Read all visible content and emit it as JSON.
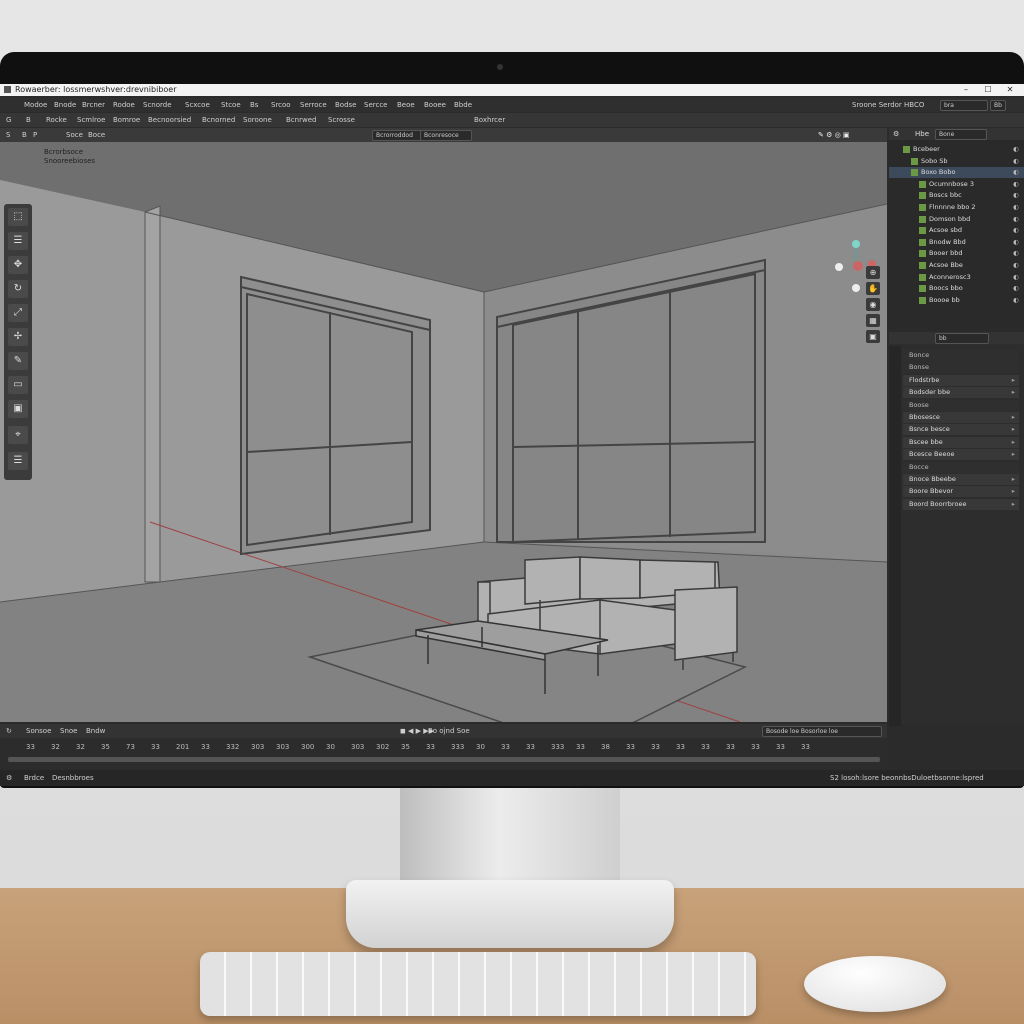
{
  "window": {
    "title": "Rowaerber: lossmerwshver:drevnibiboer",
    "controls": [
      "–",
      "☐",
      "✕"
    ]
  },
  "menubar": {
    "items": [
      "Modoe",
      "Bnode",
      "Brcner",
      "Rodoe",
      "Scnorde",
      "Scxcoe",
      "Stcoe",
      "Bs",
      "Srcoo",
      "Serroce",
      "Bodse",
      "Sercce",
      "Beoe",
      "Booee",
      "Bbde"
    ],
    "right_label": "Sroone Serdor HBCO",
    "right_search": "bra",
    "right_badge": "Bb"
  },
  "toolbar": {
    "items": [
      "Rocke",
      "Scmlroe",
      "Bomroe",
      "Becnoorsied",
      "Bcnorned",
      "Soroone",
      "Bcnrwed",
      "Scrosse",
      "Boxhrcer"
    ],
    "left_icons": [
      "G",
      "B"
    ]
  },
  "viewport_header": {
    "items": [
      "Soce",
      "Boce"
    ],
    "chips": [
      "Bcrorroddod",
      "Bconresoce"
    ],
    "left_icons": [
      "S",
      "B",
      "P"
    ]
  },
  "viewport": {
    "label_line1": "Bcrorbsoce",
    "label_line2": "Snooreebioses"
  },
  "timeline": {
    "header_items": [
      "Sonsoe",
      "Snoe",
      "Bndw"
    ],
    "center_label": "Bo ojnd Soe",
    "right_label": "Bosode loe Bosorloe loe",
    "ticks": [
      "33",
      "32",
      "32",
      "35",
      "73",
      "33",
      "201",
      "33",
      "332",
      "303",
      "303",
      "300",
      "30",
      "303",
      "302",
      "35",
      "33",
      "333",
      "30",
      "33",
      "33",
      "333",
      "33",
      "38",
      "33",
      "33",
      "33",
      "33",
      "33",
      "33",
      "33",
      "33"
    ]
  },
  "statusbar": {
    "left_label": "Brdce",
    "left_value": "Desnbbroes",
    "right_text": "S2 losoh:lsore beonnbsDuloetbsonne:lspred"
  },
  "outliner": {
    "header_title": "Hbe",
    "header_search": "Bone",
    "rows": [
      {
        "label": "Bcebeer",
        "indent": 1,
        "selected": false
      },
      {
        "label": "Sobo Sb",
        "indent": 2,
        "selected": false
      },
      {
        "label": "Boxo Bobo",
        "indent": 2,
        "selected": true
      },
      {
        "label": "Ocumnbose 3",
        "indent": 3,
        "selected": false
      },
      {
        "label": "Boscs bbc",
        "indent": 3,
        "selected": false
      },
      {
        "label": "Flnnnne bbo 2",
        "indent": 3,
        "selected": false
      },
      {
        "label": "Domson bbd",
        "indent": 3,
        "selected": false
      },
      {
        "label": "Acsoe sbd",
        "indent": 3,
        "selected": false
      },
      {
        "label": "Bnodw Bbd",
        "indent": 3,
        "selected": false
      },
      {
        "label": "Booer bbd",
        "indent": 3,
        "selected": false
      },
      {
        "label": "Acsoe Bbe",
        "indent": 3,
        "selected": false
      },
      {
        "label": "Aconnerosc3",
        "indent": 3,
        "selected": false
      },
      {
        "label": "Boocs bbo",
        "indent": 3,
        "selected": false
      },
      {
        "label": "Boooe bb",
        "indent": 3,
        "selected": false
      }
    ]
  },
  "properties": {
    "search": "bb",
    "rows": [
      {
        "label": "Bonce",
        "header": true
      },
      {
        "label": "Bonse",
        "header": true
      },
      {
        "label": "Flodstrbe",
        "header": false
      },
      {
        "label": "Bodsder bbe",
        "header": false
      },
      {
        "label": "Boose",
        "header": true
      },
      {
        "label": "Bbosesce",
        "header": false
      },
      {
        "label": "Bsnce besce",
        "header": false
      },
      {
        "label": "Bscee bbe",
        "header": false
      },
      {
        "label": "Bcesce Beeoe",
        "header": false
      },
      {
        "label": "Bocce",
        "header": true
      },
      {
        "label": "Bnoce  Bbeebe",
        "header": false
      },
      {
        "label": "Boore  Bbevor",
        "header": false
      },
      {
        "label": "Boord  Boorrbroee",
        "header": false
      }
    ]
  },
  "icons": {
    "left_tools": [
      "select-icon",
      "cursor-icon",
      "move-icon",
      "rotate-icon",
      "scale-icon",
      "transform-icon",
      "annotate-icon",
      "measure-icon",
      "add-cube-icon",
      "camera-icon",
      "light-icon"
    ],
    "nav": [
      "zoom-icon",
      "hand-icon",
      "camera-view-icon",
      "grid-icon",
      "perspective-icon"
    ]
  }
}
